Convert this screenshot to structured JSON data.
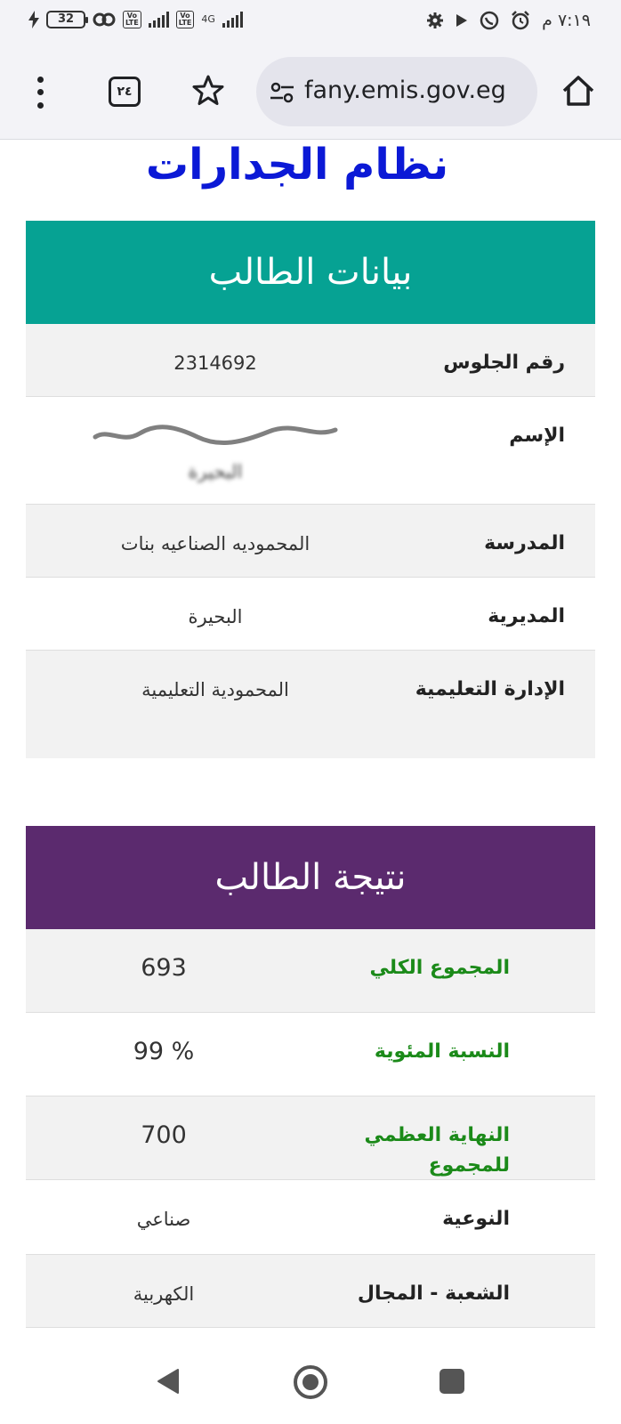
{
  "status_bar": {
    "time": "٧:١٩ م",
    "battery": "32",
    "network": "4G",
    "left_icons": [
      "charging-icon",
      "battery-icon",
      "link-icon",
      "volte-icon",
      "signal-icon",
      "volte-icon",
      "signal-4g-icon"
    ],
    "right_icons": [
      "settings-icon",
      "play-icon",
      "whatsapp-icon",
      "alarm-icon"
    ]
  },
  "browser": {
    "url": "fany.emis.gov.eg",
    "tab_count": "٢٤",
    "icons": [
      "menu-icon",
      "tabs-icon",
      "star-icon",
      "site-settings-icon",
      "home-icon"
    ]
  },
  "page": {
    "title": "نظام الجدارات"
  },
  "student_data": {
    "header": "بيانات الطالب",
    "header_color": "#06a293",
    "rows": [
      {
        "label": "رقم الجلوس",
        "value": "2314692"
      },
      {
        "label": "الإسم",
        "value": "البحيرة"
      },
      {
        "label": "المدرسة",
        "value": "المحموديه الصناعيه بنات"
      },
      {
        "label": "المديرية",
        "value": "البحيرة"
      },
      {
        "label": "الإدارة التعليمية",
        "value": "المحمودية التعليمية"
      }
    ]
  },
  "student_result": {
    "header": "نتيجة الطالب",
    "header_color": "#5b2a6e",
    "rows": [
      {
        "label": "المجموع الكلي",
        "value": "693"
      },
      {
        "label": "النسبة المئوية",
        "value": "99 %"
      },
      {
        "label": "النهاية العظمي للمجموع",
        "value": "700"
      },
      {
        "label": "النوعية",
        "value": "صناعي"
      },
      {
        "label": "الشعبة - المجال",
        "value": "الكهربية"
      }
    ]
  },
  "nav_bar": {
    "icons": [
      "back-icon",
      "home-circle-icon",
      "recents-icon"
    ]
  }
}
